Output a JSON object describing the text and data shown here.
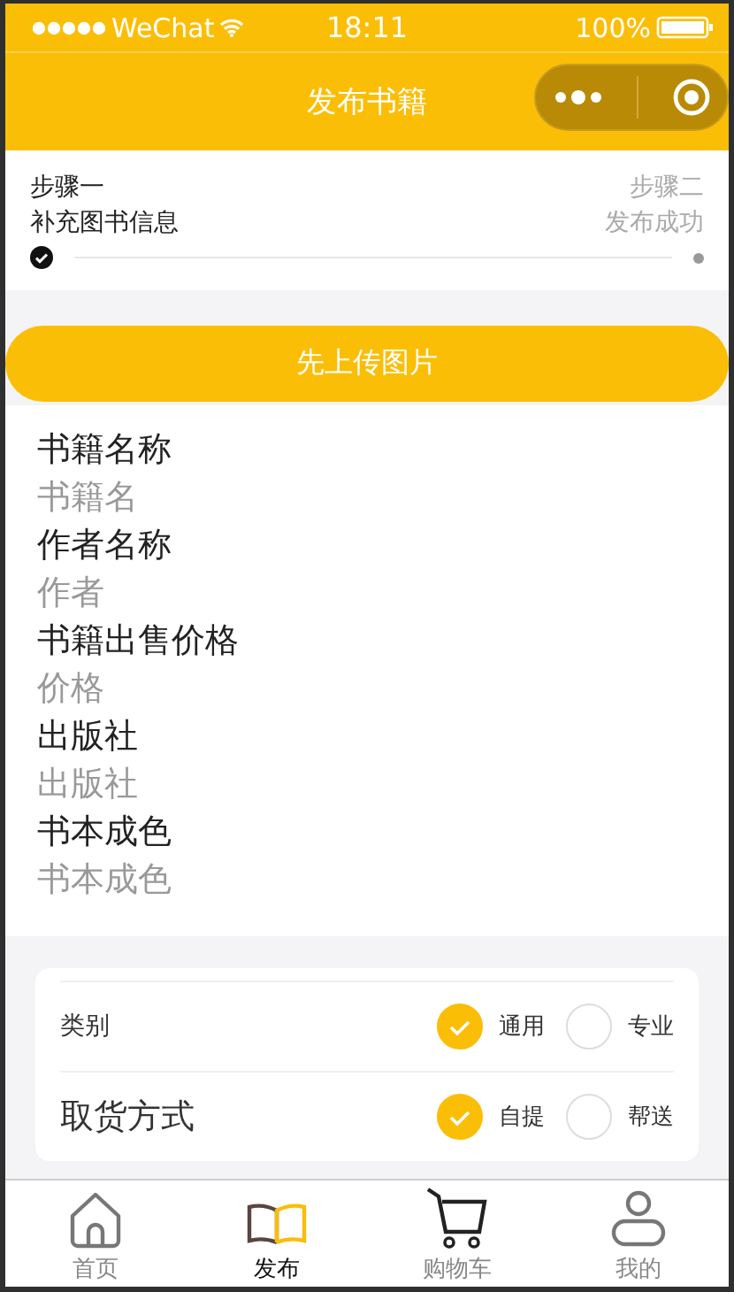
{
  "status_bar": {
    "carrier": "WeChat",
    "time": "18:11",
    "battery": "100%"
  },
  "nav": {
    "title": "发布书籍"
  },
  "steps": [
    {
      "title": "步骤一",
      "subtitle": "补充图书信息",
      "done": true
    },
    {
      "title": "步骤二",
      "subtitle": "发布成功",
      "done": false
    }
  ],
  "upload_button": "先上传图片",
  "fields": [
    {
      "label": "书籍名称",
      "placeholder": "书籍名"
    },
    {
      "label": "作者名称",
      "placeholder": "作者"
    },
    {
      "label": "书籍出售价格",
      "placeholder": "价格"
    },
    {
      "label": "出版社",
      "placeholder": "出版社"
    },
    {
      "label": "书本成色",
      "placeholder": "书本成色"
    }
  ],
  "option_groups": [
    {
      "label": "类别",
      "large": false,
      "options": [
        {
          "label": "通用",
          "selected": true
        },
        {
          "label": "专业",
          "selected": false
        }
      ]
    },
    {
      "label": "取货方式",
      "large": true,
      "options": [
        {
          "label": "自提",
          "selected": true
        },
        {
          "label": "帮送",
          "selected": false
        }
      ]
    }
  ],
  "tabs": [
    {
      "label": "首页",
      "kind": "home",
      "selected": false
    },
    {
      "label": "发布",
      "kind": "book",
      "selected": true
    },
    {
      "label": "购物车",
      "kind": "cart",
      "selected": false
    },
    {
      "label": "我的",
      "kind": "user",
      "selected": false
    }
  ]
}
